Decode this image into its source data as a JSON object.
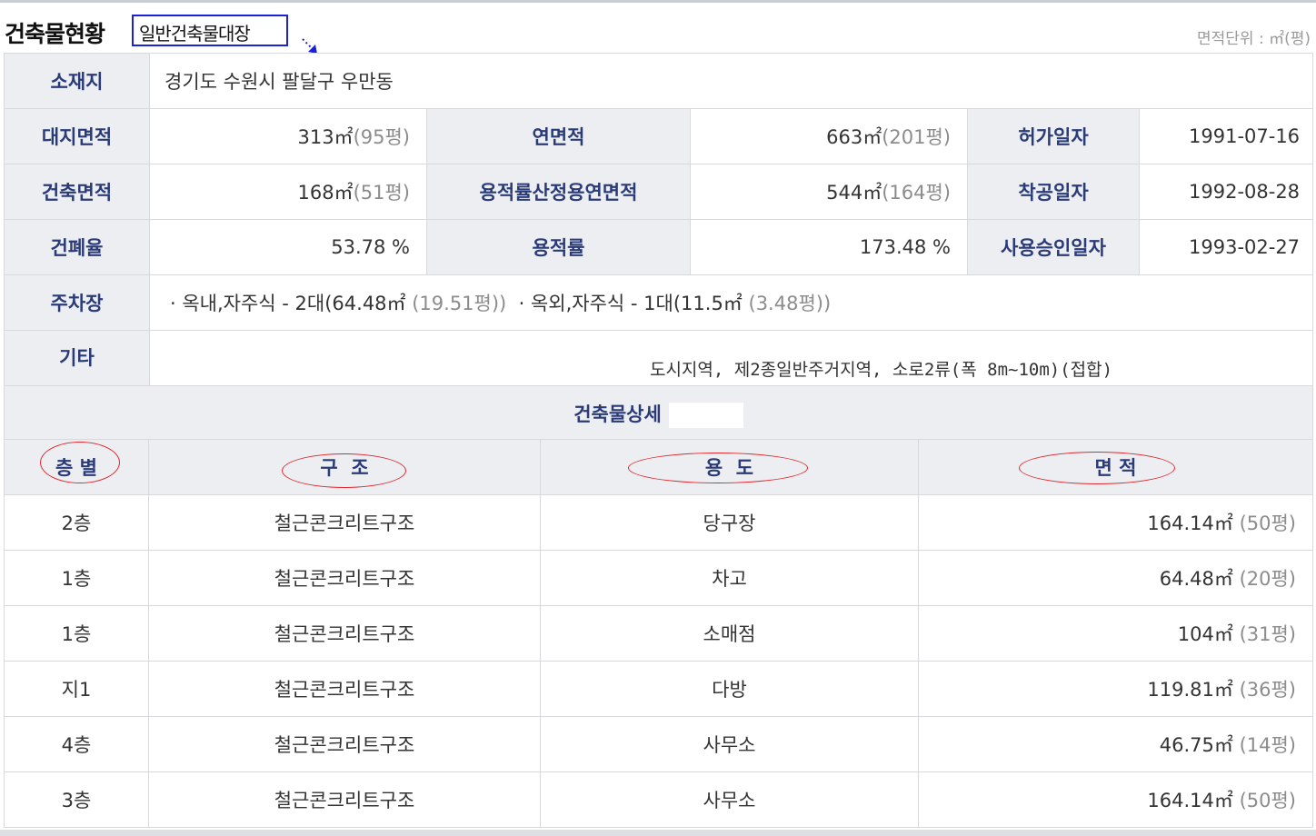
{
  "header": {
    "title": "건축물현황",
    "badge": "일반건축물대장",
    "unit": "면적단위 : ㎡(평)"
  },
  "info": {
    "location_label": "소재지",
    "location_value": "경기도 수원시 팔달구 우만동",
    "land_area_label": "대지면적",
    "land_area_value": "313㎡",
    "land_area_py": "(95평)",
    "total_floor_label": "연면적",
    "total_floor_value": "663㎡",
    "total_floor_py": "(201평)",
    "permit_label": "허가일자",
    "permit_value": "1991-07-16",
    "building_area_label": "건축면적",
    "building_area_value": "168㎡",
    "building_area_py": "(51평)",
    "far_floor_label": "용적률산정용연면적",
    "far_floor_value": "544㎡",
    "far_floor_py": "(164평)",
    "start_label": "착공일자",
    "start_value": "1992-08-28",
    "bcr_label": "건폐율",
    "bcr_value": "53.78 %",
    "far_label": "용적률",
    "far_value": "173.48 %",
    "approval_label": "사용승인일자",
    "approval_value": "1993-02-27",
    "parking_label": "주차장",
    "parking_1": "· 옥내,자주식 - 2대(64.48㎡",
    "parking_1_py": "(19.51평))",
    "parking_2": "· 옥외,자주식 - 1대(11.5㎡",
    "parking_2_py": "(3.48평))",
    "etc_label": "기타",
    "etc_value": "도시지역, 제2종일반주거지역, 소로2류(폭 8m~10m)(접합)"
  },
  "detail": {
    "section_title": "건축물상세",
    "columns": [
      "층 별",
      "구  조",
      "용  도",
      "면 적"
    ],
    "rows": [
      {
        "floor": "2층",
        "structure": "철근콘크리트구조",
        "use": "당구장",
        "area": "164.14㎡",
        "py": "(50평)"
      },
      {
        "floor": "1층",
        "structure": "철근콘크리트구조",
        "use": "차고",
        "area": "64.48㎡",
        "py": "(20평)"
      },
      {
        "floor": "1층",
        "structure": "철근콘크리트구조",
        "use": "소매점",
        "area": "104㎡",
        "py": "(31평)"
      },
      {
        "floor": "지1",
        "structure": "철근콘크리트구조",
        "use": "다방",
        "area": "119.81㎡",
        "py": "(36평)"
      },
      {
        "floor": "4층",
        "structure": "철근콘크리트구조",
        "use": "사무소",
        "area": "46.75㎡",
        "py": "(14평)"
      },
      {
        "floor": "3층",
        "structure": "철근콘크리트구조",
        "use": "사무소",
        "area": "164.14㎡",
        "py": "(50평)"
      }
    ]
  },
  "colors": {
    "header_bg": "#eceef1",
    "header_text": "#2a3b78",
    "badge_border": "#1a22d6",
    "annotation_red": "#e0282e"
  }
}
